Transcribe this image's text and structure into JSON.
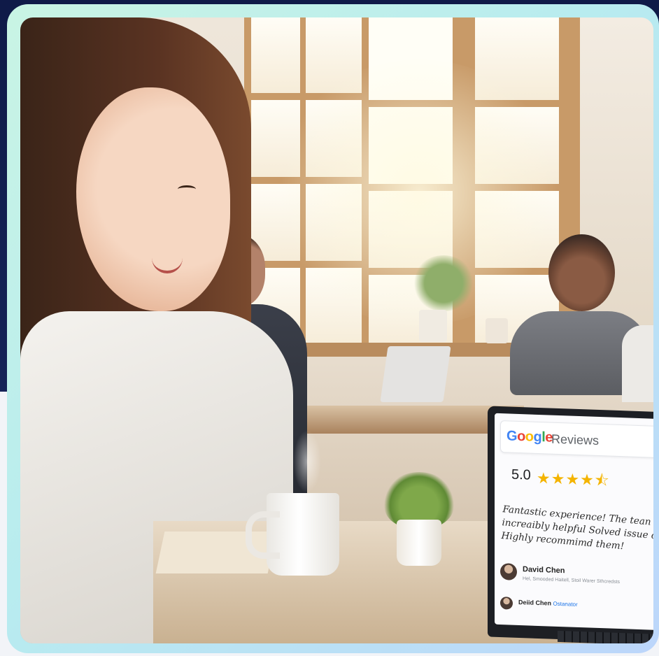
{
  "colors": {
    "navy": "#152257",
    "frame_gradient_start": "#c9f4e4",
    "frame_gradient_end": "#bcd6fb",
    "google_blue": "#4285F4",
    "google_red": "#EA4335",
    "google_yellow": "#FBBC05",
    "google_green": "#34A853",
    "star": "#f4b400"
  },
  "laptop_screen": {
    "brand_letters": [
      "G",
      "o",
      "o",
      "g",
      "l",
      "e"
    ],
    "title_suffix": "Reviews",
    "rating_value": "5.0",
    "stars": 4.5,
    "stars_glyphs": "★★★★⯪",
    "review_lines": [
      "Fantastic experience! The tean",
      "increaibly helpful Solved issue c",
      "Highly recommimd them!"
    ],
    "reviewers": [
      {
        "name": "David Chen",
        "subtext": "Hel, Smooded Haitell, Stoil Warer Sthcredsts"
      },
      {
        "name": "Deiid Chen",
        "link_text": "Ostanator"
      }
    ]
  }
}
